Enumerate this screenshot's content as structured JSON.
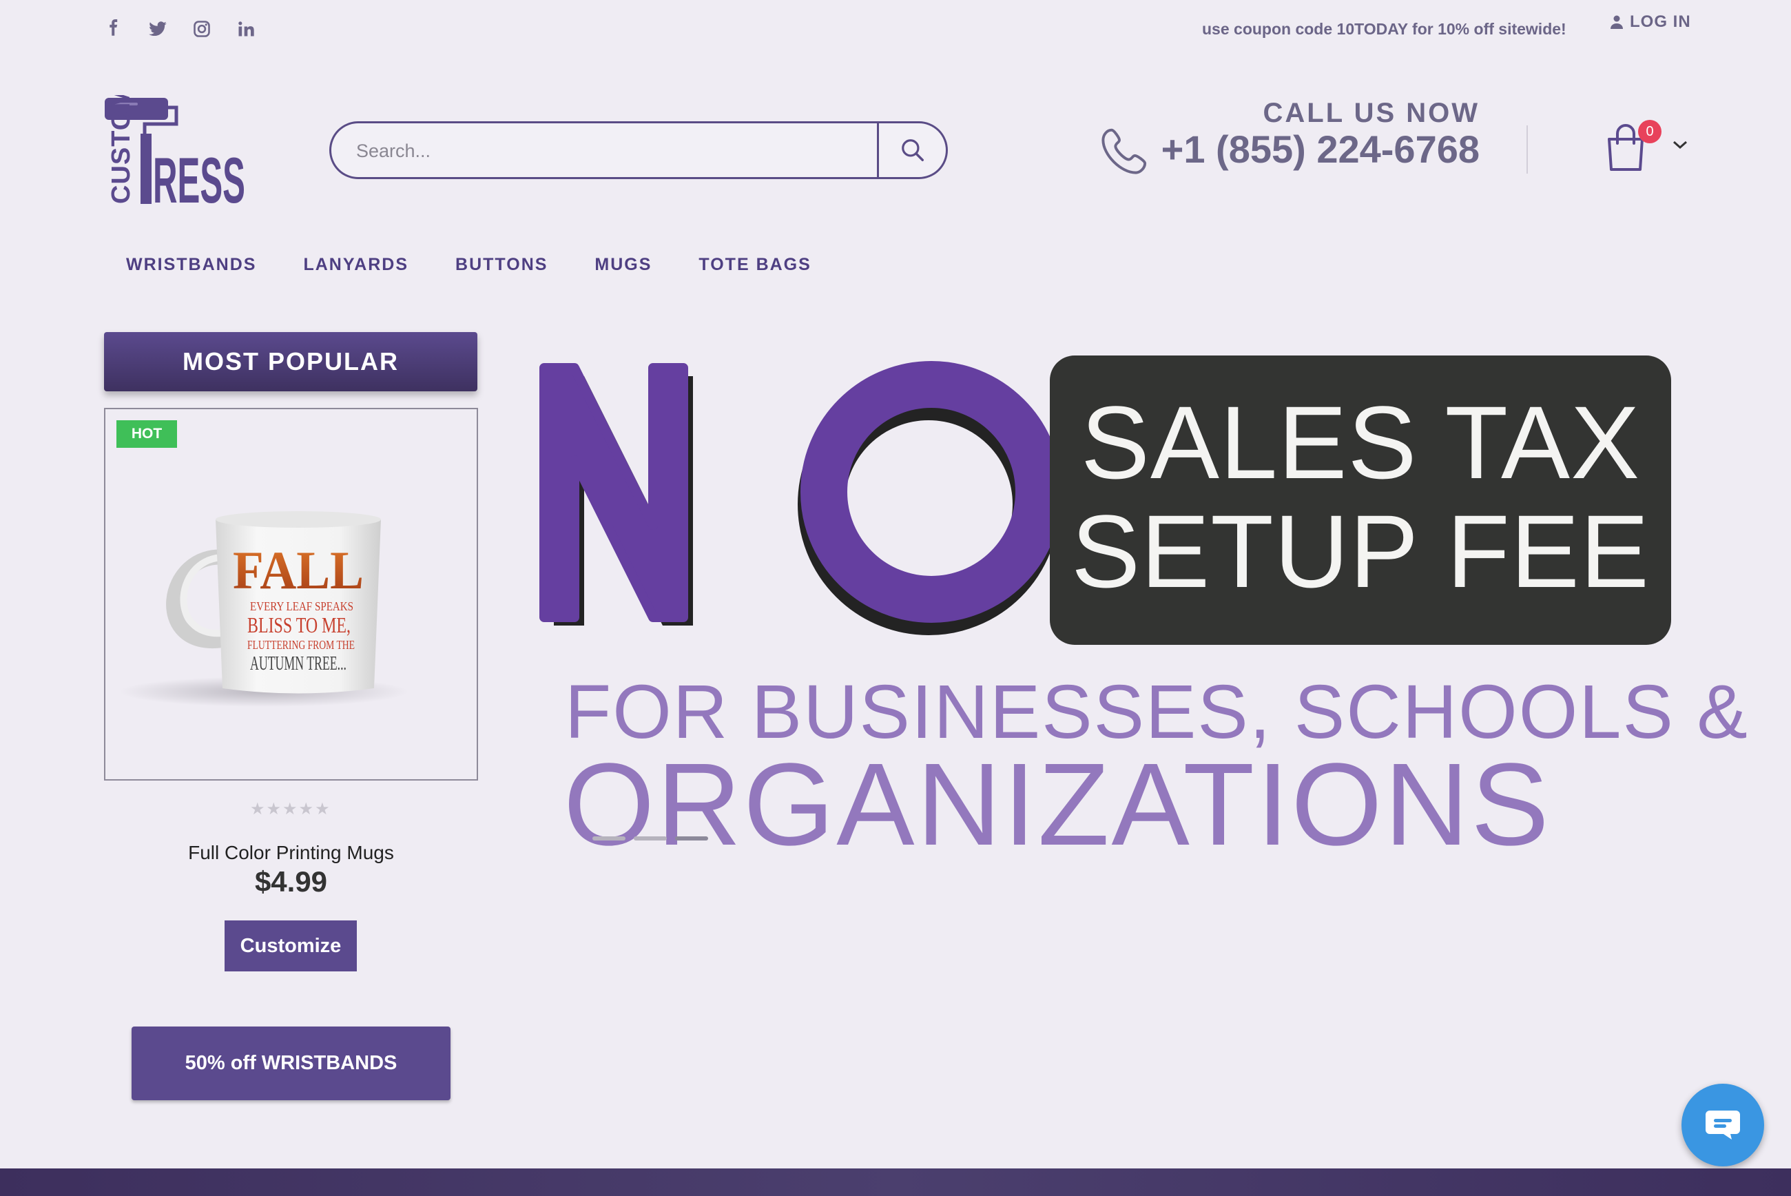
{
  "topbar": {
    "social": [
      "facebook-icon",
      "twitter-icon",
      "instagram-icon",
      "linkedin-icon"
    ],
    "coupon": "use coupon code 10TODAY for 10% off sitewide!",
    "login": "LOG IN"
  },
  "header": {
    "logo_text": "CUSTOM PRESS",
    "search_placeholder": "Search...",
    "call_label": "CALL US NOW",
    "phone": "+1 (855) 224-6768",
    "cart_count": "0"
  },
  "nav": [
    "WRISTBANDS",
    "LANYARDS",
    "BUTTONS",
    "MUGS",
    "TOTE BAGS"
  ],
  "sidebar": {
    "heading": "MOST POPULAR",
    "badge": "HOT",
    "mug_text": {
      "big": "FALL",
      "lines": [
        "EVERY LEAF SPEAKS",
        "BLISS TO ME,",
        "FLUTTERING FROM THE",
        "AUTUMN TREE..."
      ]
    },
    "rating": 0,
    "product_name": "Full Color Printing Mugs",
    "price": "$4.99",
    "customize": "Customize",
    "promo": "50% off WRISTBANDS"
  },
  "hero": {
    "big": "NO",
    "line1": "SALES TAX",
    "line2": "SETUP FEE",
    "line3": "FOR BUSINESSES, SCHOOLS &",
    "line4": "ORGANIZATIONS",
    "slides": 3,
    "active_slide": 3
  },
  "colors": {
    "brand_purple": "#5b4a8e",
    "hero_purple": "#653fa0",
    "light_purple_text": "#9378bd",
    "badge_green": "#3fbf58",
    "cart_badge": "#e8425b",
    "chat_blue": "#3a96e2"
  }
}
